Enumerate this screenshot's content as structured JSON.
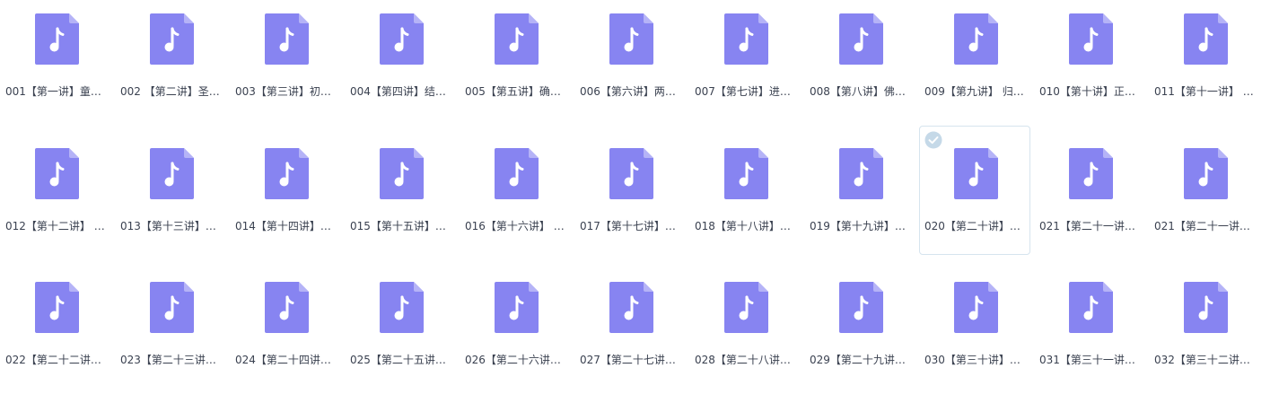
{
  "colors": {
    "icon_fill": "#8784f1",
    "icon_fold": "#b5b3f7",
    "selected_check": "#c5d9e8"
  },
  "files": [
    {
      "name": "001【第一讲】童…",
      "icon": "music-file-icon",
      "selected": false
    },
    {
      "name": "002 【第二讲】圣…",
      "icon": "music-file-icon",
      "selected": false
    },
    {
      "name": "003【第三讲】初…",
      "icon": "music-file-icon",
      "selected": false
    },
    {
      "name": "004【第四讲】结…",
      "icon": "music-file-icon",
      "selected": false
    },
    {
      "name": "005【第五讲】确…",
      "icon": "music-file-icon",
      "selected": false
    },
    {
      "name": "006【第六讲】两…",
      "icon": "music-file-icon",
      "selected": false
    },
    {
      "name": "007【第七讲】进…",
      "icon": "music-file-icon",
      "selected": false
    },
    {
      "name": "008【第八讲】佛…",
      "icon": "music-file-icon",
      "selected": false
    },
    {
      "name": "009【第九讲】 归…",
      "icon": "music-file-icon",
      "selected": false
    },
    {
      "name": "010【第十讲】正…",
      "icon": "music-file-icon",
      "selected": false
    },
    {
      "name": "011【第十一讲】 …",
      "icon": "music-file-icon",
      "selected": false
    },
    {
      "name": "012【第十二讲】 …",
      "icon": "music-file-icon",
      "selected": false
    },
    {
      "name": "013【第十三讲】…",
      "icon": "music-file-icon",
      "selected": false
    },
    {
      "name": "014【第十四讲】…",
      "icon": "music-file-icon",
      "selected": false
    },
    {
      "name": "015【第十五讲】…",
      "icon": "music-file-icon",
      "selected": false
    },
    {
      "name": "016【第十六讲】 …",
      "icon": "music-file-icon",
      "selected": false
    },
    {
      "name": "017【第十七讲】…",
      "icon": "music-file-icon",
      "selected": false
    },
    {
      "name": "018【第十八讲】…",
      "icon": "music-file-icon",
      "selected": false
    },
    {
      "name": "019【第十九讲】…",
      "icon": "music-file-icon",
      "selected": false
    },
    {
      "name": "020【第二十讲】…",
      "icon": "music-file-icon",
      "selected": true
    },
    {
      "name": "021【第二十一讲…",
      "icon": "music-file-icon",
      "selected": false
    },
    {
      "name": "021【第二十一讲…",
      "icon": "music-file-icon",
      "selected": false
    },
    {
      "name": "022【第二十二讲…",
      "icon": "music-file-icon",
      "selected": false
    },
    {
      "name": "023【第二十三讲…",
      "icon": "music-file-icon",
      "selected": false
    },
    {
      "name": "024【第二十四讲…",
      "icon": "music-file-icon",
      "selected": false
    },
    {
      "name": "025【第二十五讲…",
      "icon": "music-file-icon",
      "selected": false
    },
    {
      "name": "026【第二十六讲…",
      "icon": "music-file-icon",
      "selected": false
    },
    {
      "name": "027【第二十七讲…",
      "icon": "music-file-icon",
      "selected": false
    },
    {
      "name": "028【第二十八讲…",
      "icon": "music-file-icon",
      "selected": false
    },
    {
      "name": "029【第二十九讲…",
      "icon": "music-file-icon",
      "selected": false
    },
    {
      "name": "030【第三十讲】…",
      "icon": "music-file-icon",
      "selected": false
    },
    {
      "name": "031【第三十一讲…",
      "icon": "music-file-icon",
      "selected": false
    },
    {
      "name": "032【第三十二讲…",
      "icon": "music-file-icon",
      "selected": false
    }
  ]
}
